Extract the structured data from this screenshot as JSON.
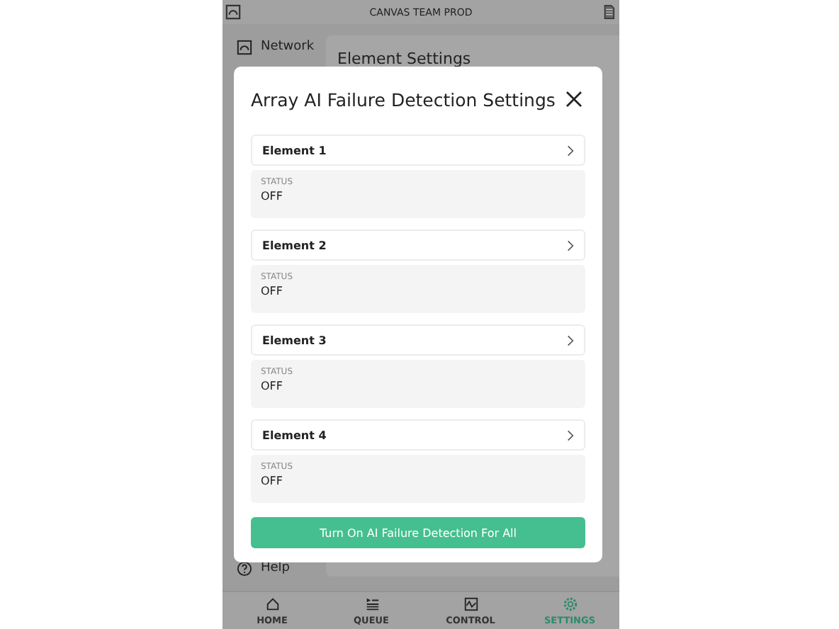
{
  "top_bar": {
    "title": "CANVAS TEAM PROD"
  },
  "sidebar": {
    "items": [
      {
        "label": "Network",
        "kind": "network"
      },
      {
        "label": "Help",
        "kind": "help"
      }
    ]
  },
  "content": {
    "heading": "Element Settings"
  },
  "modal": {
    "title": "Array AI Failure Detection Settings",
    "elements": [
      {
        "name": "Element 1",
        "status_label": "STATUS",
        "status": "OFF"
      },
      {
        "name": "Element 2",
        "status_label": "STATUS",
        "status": "OFF"
      },
      {
        "name": "Element 3",
        "status_label": "STATUS",
        "status": "OFF"
      },
      {
        "name": "Element 4",
        "status_label": "STATUS",
        "status": "OFF"
      }
    ],
    "button": "Turn On AI Failure Detection For All"
  },
  "tabs": [
    {
      "label": "HOME",
      "kind": "home",
      "selected": false
    },
    {
      "label": "QUEUE",
      "kind": "queue",
      "selected": false
    },
    {
      "label": "CONTROL",
      "kind": "control",
      "selected": false
    },
    {
      "label": "SETTINGS",
      "kind": "settings",
      "selected": true
    }
  ]
}
